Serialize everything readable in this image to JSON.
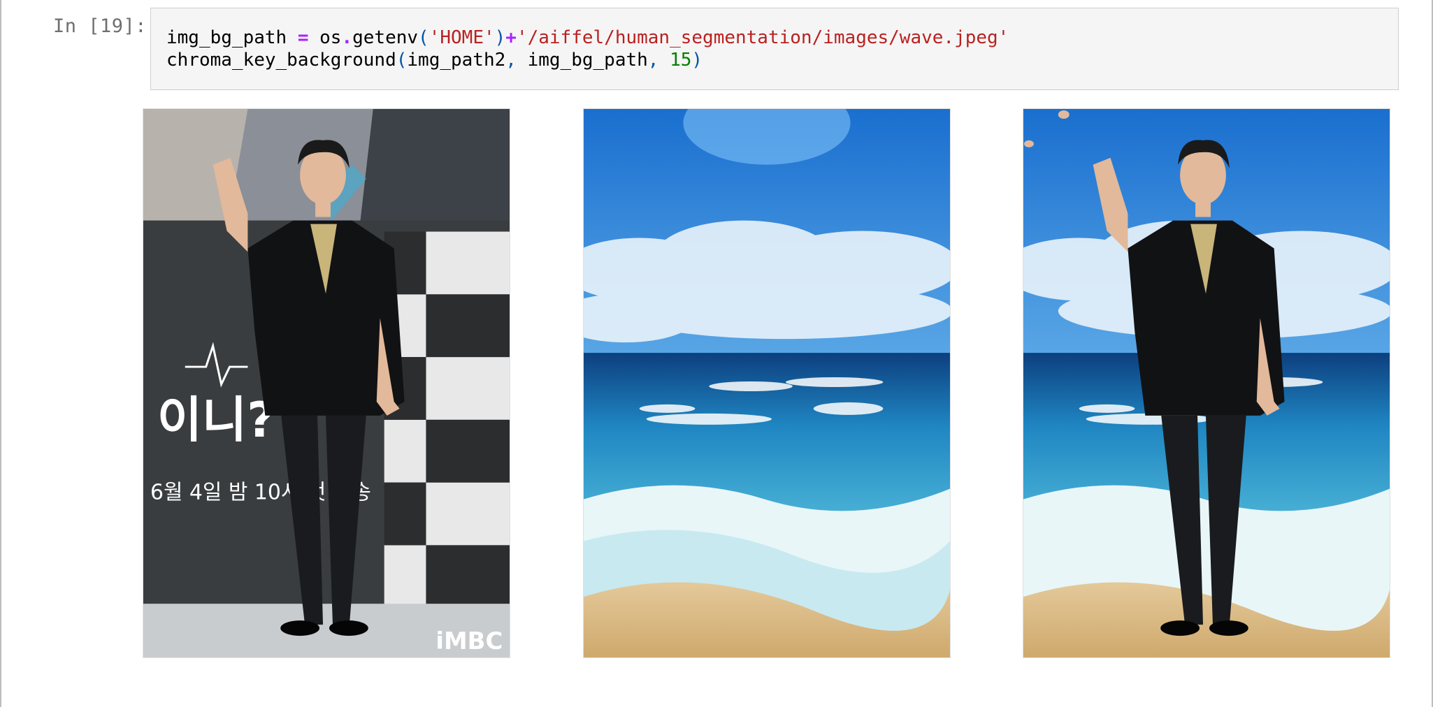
{
  "cell": {
    "prompt": "In [19]:",
    "line1": {
      "var": "img_bg_path",
      "eq": "=",
      "module": "os",
      "dot": ".",
      "func": "getenv",
      "lparen": "(",
      "arg_home": "'HOME'",
      "rparen": ")",
      "plus": "+",
      "path": "'/aiffel/human_segmentation/images/wave.jpeg'"
    },
    "line2": {
      "func": "chroma_key_background",
      "lparen": "(",
      "arg1": "img_path2",
      "comma1": ",",
      "arg2": "img_bg_path",
      "comma2": ",",
      "arg3": "15",
      "rparen": ")"
    }
  },
  "output": {
    "images": [
      {
        "name": "original-photo",
        "poster_text": "6월 4일 밤 10시 첫 방송",
        "logo_text": "iMBC"
      },
      {
        "name": "beach-background"
      },
      {
        "name": "composited-result"
      }
    ]
  }
}
